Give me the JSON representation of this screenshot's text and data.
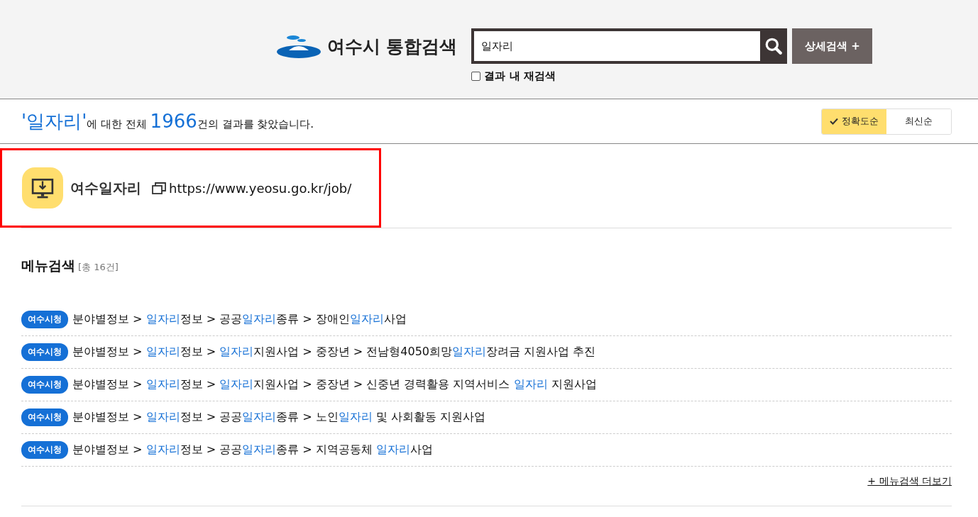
{
  "header": {
    "logo_text": "여수시 통합검색",
    "search": {
      "value": "일자리"
    },
    "detail_button": "상세검색 +",
    "research": {
      "label": "결과 내 재검색",
      "checked": false
    }
  },
  "summary": {
    "query": "'일자리'",
    "text_1": "에 대한 전체 ",
    "count": "1966",
    "text_2": "건의 결과를 찾았습니다."
  },
  "sort_tabs": [
    {
      "label": "정확도순",
      "selected": true
    },
    {
      "label": "최신순",
      "selected": false
    }
  ],
  "featured": {
    "title": "여수일자리",
    "url": "https://www.yeosu.go.kr/job/"
  },
  "menu_search": {
    "title": "메뉴검색",
    "total": "[총 16건]",
    "more": "+ 메뉴검색 더보기",
    "rows": [
      {
        "badge": "여수시청",
        "segments": [
          {
            "text": "분야별정보 > ",
            "match": false
          },
          {
            "text": "일자리",
            "match": true
          },
          {
            "text": "정보 > 공공",
            "match": false
          },
          {
            "text": "일자리",
            "match": true
          },
          {
            "text": "종류 > 장애인",
            "match": false
          },
          {
            "text": "일자리",
            "match": true
          },
          {
            "text": "사업",
            "match": false
          }
        ]
      },
      {
        "badge": "여수시청",
        "segments": [
          {
            "text": "분야별정보 > ",
            "match": false
          },
          {
            "text": "일자리",
            "match": true
          },
          {
            "text": "정보 > ",
            "match": false
          },
          {
            "text": "일자리",
            "match": true
          },
          {
            "text": "지원사업 > 중장년 > 전남형4050희망",
            "match": false
          },
          {
            "text": "일자리",
            "match": true
          },
          {
            "text": "장려금 지원사업 추진",
            "match": false
          }
        ]
      },
      {
        "badge": "여수시청",
        "segments": [
          {
            "text": "분야별정보 > ",
            "match": false
          },
          {
            "text": "일자리",
            "match": true
          },
          {
            "text": "정보 > ",
            "match": false
          },
          {
            "text": "일자리",
            "match": true
          },
          {
            "text": "지원사업 > 중장년 > 신중년 경력활용 지역서비스 ",
            "match": false
          },
          {
            "text": "일자리",
            "match": true
          },
          {
            "text": " 지원사업",
            "match": false
          }
        ]
      },
      {
        "badge": "여수시청",
        "segments": [
          {
            "text": "분야별정보 > ",
            "match": false
          },
          {
            "text": "일자리",
            "match": true
          },
          {
            "text": "정보 > 공공",
            "match": false
          },
          {
            "text": "일자리",
            "match": true
          },
          {
            "text": "종류 > 노인",
            "match": false
          },
          {
            "text": "일자리",
            "match": true
          },
          {
            "text": " 및 사회활동 지원사업",
            "match": false
          }
        ]
      },
      {
        "badge": "여수시청",
        "segments": [
          {
            "text": "분야별정보 > ",
            "match": false
          },
          {
            "text": "일자리",
            "match": true
          },
          {
            "text": "정보 > 공공",
            "match": false
          },
          {
            "text": "일자리",
            "match": true
          },
          {
            "text": "종류 > 지역공동체 ",
            "match": false
          },
          {
            "text": "일자리",
            "match": true
          },
          {
            "text": "사업",
            "match": false
          }
        ]
      }
    ]
  }
}
